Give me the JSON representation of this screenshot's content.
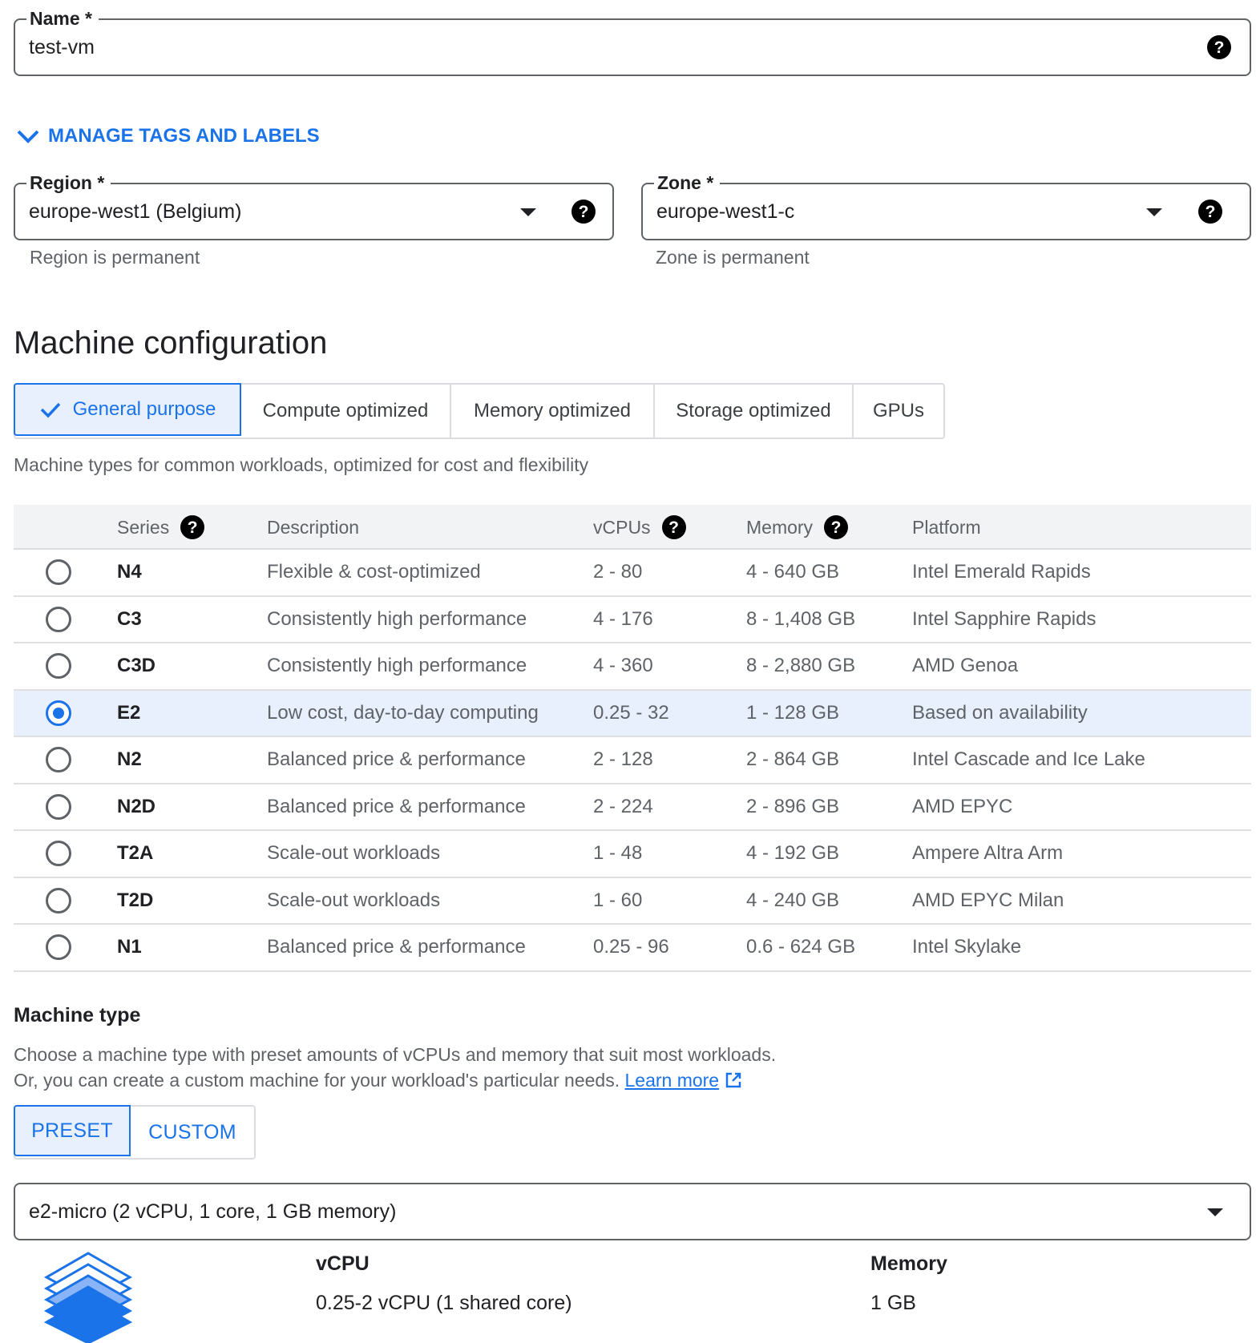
{
  "name_field": {
    "label": "Name *",
    "value": "test-vm"
  },
  "manage_tags": {
    "label": "MANAGE TAGS AND LABELS"
  },
  "region_field": {
    "label": "Region *",
    "value": "europe-west1 (Belgium)",
    "hint": "Region is permanent"
  },
  "zone_field": {
    "label": "Zone *",
    "value": "europe-west1-c",
    "hint": "Zone is permanent"
  },
  "machine_config": {
    "title": "Machine configuration",
    "tabs": [
      {
        "label": "General purpose",
        "active": true
      },
      {
        "label": "Compute optimized"
      },
      {
        "label": "Memory optimized"
      },
      {
        "label": "Storage optimized"
      },
      {
        "label": "GPUs"
      }
    ],
    "tab_description": "Machine types for common workloads, optimized for cost and flexibility"
  },
  "series_table": {
    "columns": [
      "Series",
      "Description",
      "vCPUs",
      "Memory",
      "Platform"
    ],
    "rows": [
      {
        "series": "N4",
        "description": "Flexible & cost-optimized",
        "vcpus": "2 - 80",
        "memory": "4 - 640 GB",
        "platform": "Intel Emerald Rapids"
      },
      {
        "series": "C3",
        "description": "Consistently high performance",
        "vcpus": "4 - 176",
        "memory": "8 - 1,408 GB",
        "platform": "Intel Sapphire Rapids"
      },
      {
        "series": "C3D",
        "description": "Consistently high performance",
        "vcpus": "4 - 360",
        "memory": "8 - 2,880 GB",
        "platform": "AMD Genoa"
      },
      {
        "series": "E2",
        "description": "Low cost, day-to-day computing",
        "vcpus": "0.25 - 32",
        "memory": "1 - 128 GB",
        "platform": "Based on availability",
        "selected": true
      },
      {
        "series": "N2",
        "description": "Balanced price & performance",
        "vcpus": "2 - 128",
        "memory": "2 - 864 GB",
        "platform": "Intel Cascade and Ice Lake"
      },
      {
        "series": "N2D",
        "description": "Balanced price & performance",
        "vcpus": "2 - 224",
        "memory": "2 - 896 GB",
        "platform": "AMD EPYC"
      },
      {
        "series": "T2A",
        "description": "Scale-out workloads",
        "vcpus": "1 - 48",
        "memory": "4 - 192 GB",
        "platform": "Ampere Altra Arm"
      },
      {
        "series": "T2D",
        "description": "Scale-out workloads",
        "vcpus": "1 - 60",
        "memory": "4 - 240 GB",
        "platform": "AMD EPYC Milan"
      },
      {
        "series": "N1",
        "description": "Balanced price & performance",
        "vcpus": "0.25 - 96",
        "memory": "0.6 - 624 GB",
        "platform": "Intel Skylake"
      }
    ]
  },
  "machine_type": {
    "title": "Machine type",
    "description_line1": "Choose a machine type with preset amounts of vCPUs and memory that suit most workloads.",
    "description_line2": "Or, you can create a custom machine for your workload's particular needs.",
    "learn_more": "Learn more",
    "preset_label": "PRESET",
    "custom_label": "CUSTOM",
    "selected": "e2-micro (2 vCPU, 1 core, 1 GB memory)",
    "vcpu_header": "vCPU",
    "vcpu_value": "0.25-2 vCPU (1 shared core)",
    "memory_header": "Memory",
    "memory_value": "1 GB"
  },
  "icons": {
    "help": "help-circle-icon",
    "dropdown": "arrow-drop-down-icon",
    "expand": "chevron-down-icon",
    "check": "check-icon",
    "external": "open-in-new-icon",
    "machine": "layers-stack-icon"
  },
  "colors": {
    "accent": "#1a73e8",
    "selected_bg": "#e8f0fe",
    "header_bg": "#f1f3f4"
  }
}
